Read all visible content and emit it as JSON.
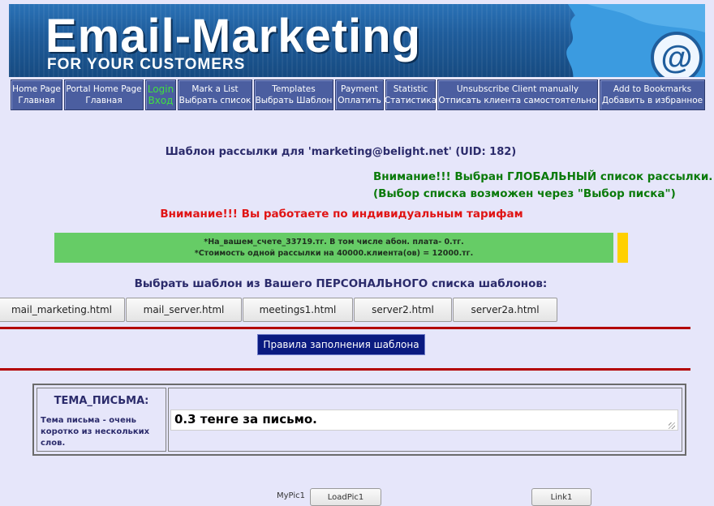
{
  "banner": {
    "title": "Email-Marketing",
    "subtitle": "FOR YOUR CUSTOMERS",
    "at_symbol": "@",
    "accent_color": "#1f5d9c"
  },
  "menu": [
    {
      "line1": "Home Page",
      "line2": "Главная",
      "width": 64
    },
    {
      "line1": "Portal Home Page",
      "line2": "Главная",
      "width": 98
    },
    {
      "line1": "Login",
      "line2": "Вход",
      "width": 38,
      "login": true
    },
    {
      "line1": "Mark a List",
      "line2": "Выбрать список",
      "width": 92
    },
    {
      "line1": "Templates",
      "line2": "Выбрать Шаблон",
      "width": 98
    },
    {
      "line1": "Payment",
      "line2": "Оплатить",
      "width": 60
    },
    {
      "line1": "Statistic",
      "line2": "Статистика",
      "width": 62
    },
    {
      "line1": "Unsubscribe Client manually",
      "line2": "Отписать клиента самостоятельно",
      "width": 198
    },
    {
      "line1": "Add to Bookmarks",
      "line2": "Добавить в избранное",
      "width": 130
    }
  ],
  "heading": "Шаблон рассылки для 'marketing@belight.net' (UID: 182)",
  "global_note": {
    "line1": "Внимание!!! Выбран ГЛОБАЛЬНЫЙ список рассылки.",
    "line2": "(Выбор списка возможен через \"Выбор писка\")"
  },
  "tariff_note": "Внимание!!! Вы работаете по индивидуальным тарифам",
  "balance": {
    "line1": "*На_вашем_счете_33719.тг. В том числе абон. плата- 0.тг.",
    "line2": "*Стоимость одной рассылки на 40000.клиента(ов) = 12000.тг."
  },
  "choose_label": "Выбрать шаблон из Вашего ПЕРСОНАЛЬНОГО списка шаблонов:",
  "templates": [
    {
      "label": "mail_marketing.html",
      "width": 156
    },
    {
      "label": "mail_server.html",
      "width": 143
    },
    {
      "label": "meetings1.html",
      "width": 136
    },
    {
      "label": "server2.html",
      "width": 121
    },
    {
      "label": "server2a.html",
      "width": 129
    }
  ],
  "rules_button": "Правила заполнения шаблона",
  "subject": {
    "header": "ТЕМА_ПИСЬМА:",
    "description": "Тема письма - очень коротко из нескольких слов.",
    "value": "0.3 тенге за письмо."
  },
  "bottom": {
    "label": "MyPic1",
    "load_button": "LoadPic1",
    "link_button": "Link1"
  }
}
